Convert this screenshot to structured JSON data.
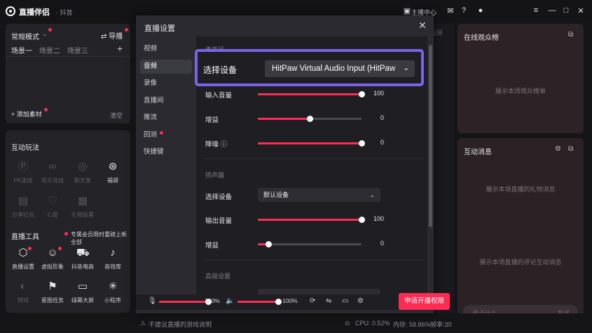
{
  "titlebar": {
    "app_name": "直播伴侣",
    "app_sub": "· 抖音",
    "host_center": "主播中心"
  },
  "left": {
    "mode": "常规模式",
    "import": "导播",
    "scenes": [
      "场景一",
      "场景二",
      "场景三"
    ],
    "add_material": "添加素材",
    "clear": "清空",
    "interactive_title": "互动玩法",
    "interactive": [
      "PK连线",
      "观众连线",
      "聊天室",
      "福袋",
      "分享红包",
      "心愿",
      "礼物投票"
    ],
    "tools_title": "直播工具",
    "vip_note": "专属会员限时重磅上新 全部",
    "tools": [
      "直播设置",
      "虚拟形象",
      "抖音电商",
      "音效库",
      "特效",
      "星图任务",
      "绿幕大屏",
      "小程序"
    ]
  },
  "center": {
    "top_tag": "投屏"
  },
  "right": {
    "viewers_title": "在线观众榜",
    "viewers_empty": "展示本场观众榜单",
    "messages_title": "互动消息",
    "gift_empty": "展示本场直播的礼物消息",
    "comment_empty": "展示本场直播的评论互动消息",
    "say_placeholder": "说点什么",
    "send": "发送"
  },
  "modal": {
    "title": "直播设置",
    "nav": [
      "视频",
      "音频",
      "录像",
      "直播间",
      "推流",
      "回测",
      "快捷键"
    ],
    "mic_section": "麦克风",
    "select_device_label": "选择设备",
    "mic_device": "HitPaw Virtual Audio Input (HitPaw",
    "input_volume_label": "输入音量",
    "input_volume": 100,
    "gain_label": "增益",
    "gain": 0,
    "noise_label": "降噪",
    "noise": 0,
    "speaker_section": "扬声器",
    "speaker_device_label": "选择设备",
    "speaker_device": "默认设备",
    "output_volume_label": "输出音量",
    "output_volume": 100,
    "speaker_gain_label": "增益",
    "speaker_gain": 0,
    "advanced_section": "高级设置"
  },
  "controls": {
    "mic_percent": "100%",
    "speaker_percent": "100%",
    "go_live": "申请开播权限"
  },
  "statusbar": {
    "warning": "不建议直播的游戏说明",
    "cpu": "CPU: 0.52%",
    "mem": "内存: 58.86%",
    "fps": "帧率:30"
  },
  "colors": {
    "accent": "#fe2c55",
    "highlight": "#7b63e8"
  }
}
